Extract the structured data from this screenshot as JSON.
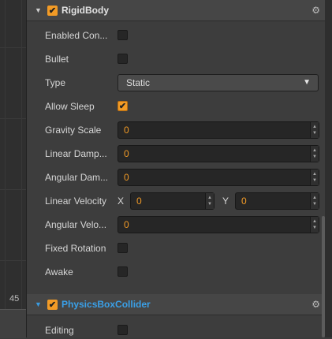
{
  "viewport": {
    "ruler_value": "45"
  },
  "rigidbody": {
    "title": "RigidBody",
    "enabled": true,
    "props": {
      "enabled_contact_label": "Enabled Con...",
      "enabled_contact": false,
      "bullet_label": "Bullet",
      "bullet": false,
      "type_label": "Type",
      "type_value": "Static",
      "allow_sleep_label": "Allow Sleep",
      "allow_sleep": true,
      "gravity_scale_label": "Gravity Scale",
      "gravity_scale": "0",
      "linear_damping_label": "Linear Damp...",
      "linear_damping": "0",
      "angular_damping_label": "Angular Dam...",
      "angular_damping": "0",
      "linear_velocity_label": "Linear Velocity",
      "linear_velocity_x_label": "X",
      "linear_velocity_x": "0",
      "linear_velocity_y_label": "Y",
      "linear_velocity_y": "0",
      "angular_velocity_label": "Angular Velo...",
      "angular_velocity": "0",
      "fixed_rotation_label": "Fixed Rotation",
      "fixed_rotation": false,
      "awake_label": "Awake",
      "awake": false
    }
  },
  "collider": {
    "title": "PhysicsBoxCollider",
    "enabled": true,
    "props": {
      "editing_label": "Editing",
      "editing": false
    }
  },
  "colors": {
    "accent": "#f29b26",
    "link": "#3aa0e8"
  }
}
